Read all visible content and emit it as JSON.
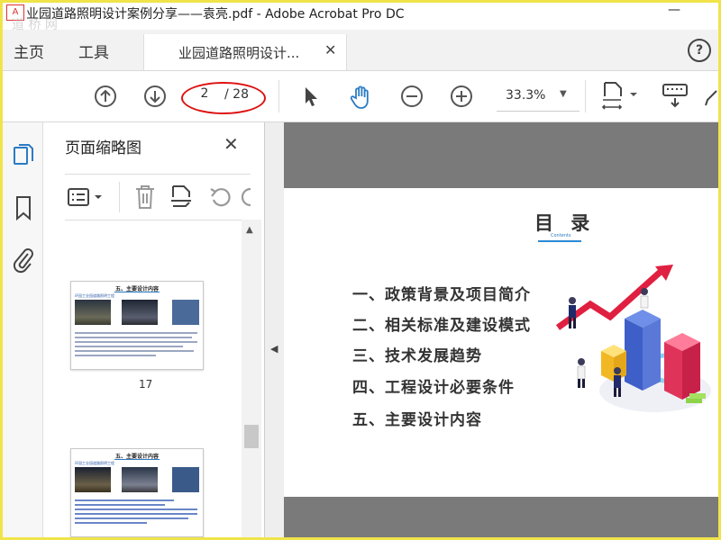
{
  "window": {
    "title": "业园道路照明设计案例分享——袁亮.pdf - Adobe Acrobat Pro DC",
    "watermark": "道 桥 网",
    "logo_glyph": "A",
    "minimize_glyph": "—"
  },
  "menu": {
    "home_label": "主页",
    "tools_label": "工具"
  },
  "tab": {
    "label": "业园道路照明设计...",
    "close_glyph": "✕"
  },
  "help": {
    "glyph": "?"
  },
  "toolbar": {
    "page_current": "2",
    "page_total": "/ 28",
    "zoom": "33.3%",
    "zoom_caret": "▼"
  },
  "thumbnails_panel": {
    "title": "页面缩略图",
    "close_glyph": "✕",
    "scroll_up_glyph": "▲",
    "thumbs": [
      {
        "page_label": "17",
        "title": "五、主要设计内容",
        "subtitle": "环园工业园道路照明工程"
      },
      {
        "page_label": "",
        "title": "五、主要设计内容",
        "subtitle": "环园工业园道路照明工程"
      }
    ]
  },
  "splitter": {
    "collapse_glyph": "◀"
  },
  "document": {
    "toc_title": "目 录",
    "toc_subtitle": "Contents",
    "toc_items": [
      "一、政策背景及项目简介",
      "二、相关标准及建设模式",
      "三、技术发展趋势",
      "四、工程设计必要条件",
      "五、主要设计内容"
    ]
  },
  "icons": {
    "toolbar": [
      "arrow-up-circle-icon",
      "arrow-down-circle-icon",
      "select-pointer-icon",
      "hand-icon",
      "zoom-out-icon",
      "zoom-in-icon",
      "fit-page-icon",
      "keyboard-icon"
    ],
    "rail": [
      "pages-icon",
      "bookmark-icon",
      "attachment-icon"
    ],
    "pane_tools": [
      "options-list-icon",
      "delete-icon",
      "insert-page-icon",
      "rotate-icon"
    ]
  },
  "colors": {
    "frame_border": "#f0e44a",
    "accent_blue": "#2b7bc4",
    "highlight_red": "#d11111"
  }
}
